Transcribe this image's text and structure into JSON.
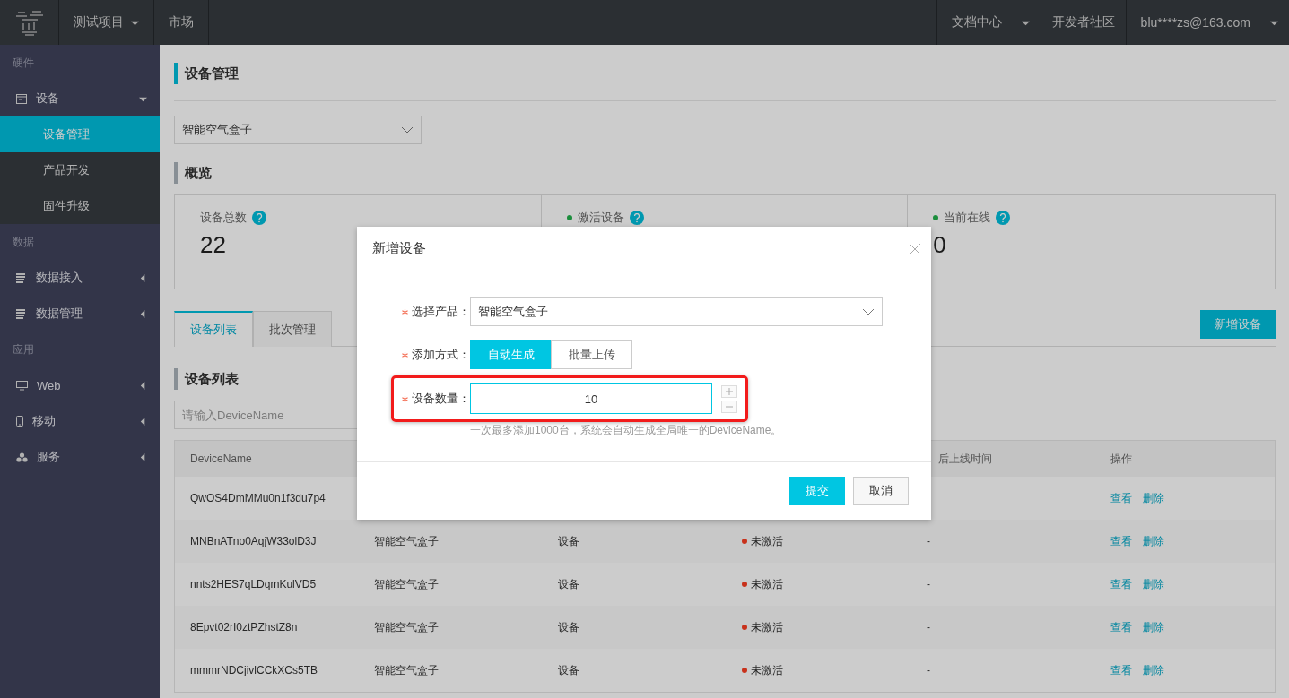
{
  "topbar": {
    "left": [
      {
        "label": "测试项目",
        "dropdown": true
      },
      {
        "label": "市场",
        "dropdown": false
      }
    ],
    "right": [
      {
        "label": "文档中心",
        "dropdown": true
      },
      {
        "label": "开发者社区",
        "dropdown": false
      },
      {
        "label": "blu****zs@163.com",
        "dropdown": true
      }
    ]
  },
  "sidebar": {
    "sections": [
      {
        "label": "硬件",
        "items": [
          {
            "label": "设备",
            "kind": "window",
            "expanded": true,
            "children": [
              {
                "label": "设备管理",
                "selected": true
              },
              {
                "label": "产品开发",
                "selected": false
              },
              {
                "label": "固件升级",
                "selected": false
              }
            ]
          }
        ]
      },
      {
        "label": "数据",
        "items": [
          {
            "label": "数据接入",
            "kind": "server",
            "expanded": false
          },
          {
            "label": "数据管理",
            "kind": "server",
            "expanded": false
          }
        ]
      },
      {
        "label": "应用",
        "items": [
          {
            "label": "Web",
            "kind": "monitor",
            "expanded": false
          },
          {
            "label": "移动",
            "kind": "phone",
            "expanded": false
          },
          {
            "label": "服务",
            "kind": "cluster",
            "expanded": false
          }
        ]
      }
    ]
  },
  "page": {
    "title": "设备管理",
    "product_select": {
      "value": "智能空气盒子"
    },
    "overview_title": "概览",
    "stats": [
      {
        "label": "设备总数",
        "value": "22",
        "status_dot": false
      },
      {
        "label": "激活设备",
        "status_dot": true
      },
      {
        "label": "当前在线",
        "value": "0",
        "status_dot": true
      }
    ],
    "tabs": [
      {
        "label": "设备列表",
        "selected": true
      },
      {
        "label": "批次管理",
        "selected": false
      }
    ],
    "add_button": "新增设备",
    "list_title": "设备列表",
    "search": {
      "placeholder": "请输入DeviceName"
    },
    "table": {
      "columns": {
        "column_1": "DeviceName",
        "column_5": "后上线时间",
        "column_6": "操作"
      },
      "rows": [
        {
          "name": "QwOS4DmMMu0n1f3du7p4",
          "actions": [
            "查看",
            "删除"
          ]
        },
        {
          "name": "MNBnATno0AqjW33olD3J",
          "product": "智能空气盒子",
          "type": "设备",
          "status": {
            "label": "未激活",
            "color": "#c8311b"
          },
          "last_online": "-",
          "actions": [
            "查看",
            "删除"
          ]
        },
        {
          "name": "nnts2HES7qLDqmKulVD5",
          "product": "智能空气盒子",
          "type": "设备",
          "status": {
            "label": "未激活",
            "color": "#c8311b"
          },
          "last_online": "-",
          "actions": [
            "查看",
            "删除"
          ]
        },
        {
          "name": "8Epvt02rI0ztPZhstZ8n",
          "product": "智能空气盒子",
          "type": "设备",
          "status": {
            "label": "未激活",
            "color": "#c8311b"
          },
          "last_online": "-",
          "actions": [
            "查看",
            "删除"
          ]
        },
        {
          "name": "mmmrNDCjivlCCkXCs5TB",
          "product": "智能空气盒子",
          "type": "设备",
          "status": {
            "label": "未激活",
            "color": "#c8311b"
          },
          "last_online": "-",
          "actions": [
            "查看",
            "删除"
          ]
        }
      ]
    }
  },
  "modal": {
    "title": "新增设备",
    "fields": [
      {
        "kind": "select",
        "label": "选择产品：",
        "required": true,
        "value": "智能空气盒子"
      },
      {
        "kind": "toggle",
        "label": "添加方式：",
        "required": true,
        "options": [
          {
            "label": "自动生成",
            "selected": true
          },
          {
            "label": "批量上传",
            "selected": false
          }
        ]
      },
      {
        "kind": "number",
        "label": "设备数量：",
        "required": true,
        "value": "10",
        "focused": true,
        "highlighted": true,
        "hint": "一次最多添加1000台，系统会自动生成全局唯一的DeviceName。"
      }
    ],
    "buttons": [
      {
        "label": "提交",
        "primary": true
      },
      {
        "label": "取消",
        "primary": false
      }
    ]
  }
}
